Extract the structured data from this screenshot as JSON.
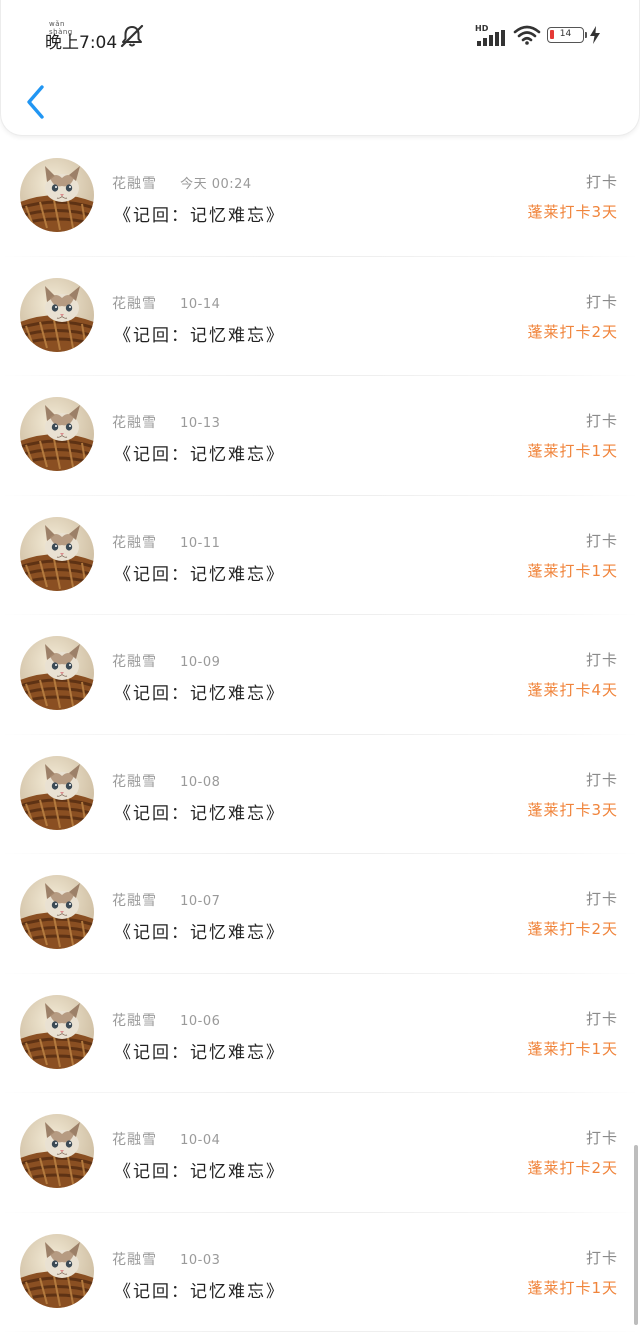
{
  "status_bar": {
    "time": "晚上7:04",
    "time_ruby": "wǎn shàng",
    "network_label": "HD",
    "battery_level": "14",
    "battery_percent": 14
  },
  "colors": {
    "accent_blue": "#2196F3",
    "reward_orange": "#f0843b",
    "muted_gray": "#9a9a9a",
    "battery_low_red": "#e53935"
  },
  "icons": {
    "back": "chevron-left-icon",
    "mute": "bell-off-icon",
    "signal": "signal-icon",
    "wifi": "wifi-icon",
    "battery": "battery-icon",
    "charging": "bolt-icon"
  },
  "list": {
    "action_label": "打卡",
    "items": [
      {
        "author": "花融雪",
        "date": "今天 00:24",
        "title": "《记回：记忆难忘》",
        "reward": "蓬莱打卡3天"
      },
      {
        "author": "花融雪",
        "date": "10-14",
        "title": "《记回：记忆难忘》",
        "reward": "蓬莱打卡2天"
      },
      {
        "author": "花融雪",
        "date": "10-13",
        "title": "《记回：记忆难忘》",
        "reward": "蓬莱打卡1天"
      },
      {
        "author": "花融雪",
        "date": "10-11",
        "title": "《记回：记忆难忘》",
        "reward": "蓬莱打卡1天"
      },
      {
        "author": "花融雪",
        "date": "10-09",
        "title": "《记回：记忆难忘》",
        "reward": "蓬莱打卡4天"
      },
      {
        "author": "花融雪",
        "date": "10-08",
        "title": "《记回：记忆难忘》",
        "reward": "蓬莱打卡3天"
      },
      {
        "author": "花融雪",
        "date": "10-07",
        "title": "《记回：记忆难忘》",
        "reward": "蓬莱打卡2天"
      },
      {
        "author": "花融雪",
        "date": "10-06",
        "title": "《记回：记忆难忘》",
        "reward": "蓬莱打卡1天"
      },
      {
        "author": "花融雪",
        "date": "10-04",
        "title": "《记回：记忆难忘》",
        "reward": "蓬莱打卡2天"
      },
      {
        "author": "花融雪",
        "date": "10-03",
        "title": "《记回：记忆难忘》",
        "reward": "蓬莱打卡1天"
      }
    ]
  }
}
